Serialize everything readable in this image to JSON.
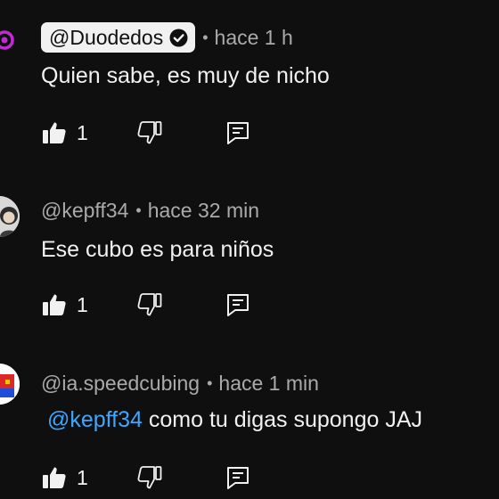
{
  "comments": [
    {
      "handle": "@Duodedos",
      "verified": true,
      "separator": "•",
      "time": "hace 1 h",
      "text": "Quien sabe, es muy de nicho",
      "likes": "1",
      "avatar_color": "#c02bd3"
    },
    {
      "handle": "@kepff34",
      "verified": false,
      "separator": "•",
      "time": "hace 32 min",
      "text": "Ese cubo es para niños",
      "likes": "1",
      "avatar_color": "#d8d8d8"
    },
    {
      "handle": "@ia.speedcubing",
      "verified": false,
      "separator": "•",
      "time": "hace 1 min",
      "mention": "@kepff34",
      "text": " como tu digas supongo JAJ",
      "likes": "1",
      "avatar_color": "#e0262b"
    }
  ],
  "colors": {
    "background": "#0f0f0f",
    "primary_text": "#f1f1f1",
    "secondary_text": "#aaaaaa",
    "mention": "#3ea6ff"
  },
  "icons": [
    "thumbs-up-filled-icon",
    "thumbs-down-outline-icon",
    "reply-comment-icon",
    "verified-check-icon"
  ]
}
